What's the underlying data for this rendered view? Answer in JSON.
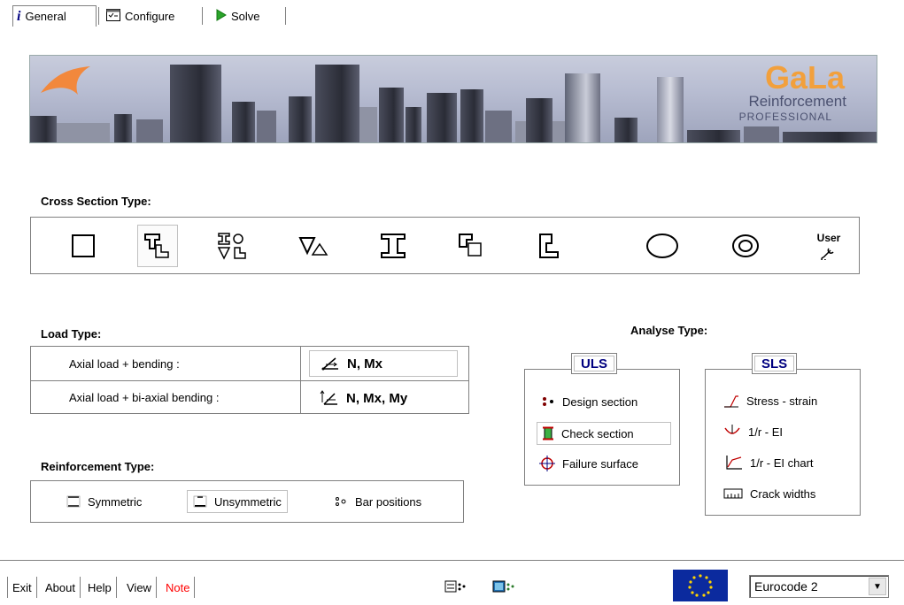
{
  "tabs": [
    {
      "label": "General",
      "icon": "info-icon"
    },
    {
      "label": "Configure",
      "icon": "configure-icon"
    },
    {
      "label": "Solve",
      "icon": "play-icon"
    }
  ],
  "banner": {
    "title": "GaLa",
    "subtitle": "Reinforcement",
    "edition": "PROFESSIONAL"
  },
  "cross_section": {
    "label": "Cross Section Type:",
    "user_label": "User",
    "selected_index": 1,
    "types": [
      "rectangle",
      "t-section",
      "multi-section",
      "triangle",
      "i-section",
      "box-section",
      "l-section",
      "circle",
      "ring",
      "user"
    ]
  },
  "load_type": {
    "label": "Load Type:",
    "rows": [
      {
        "description": "Axial load + bending :",
        "value": "N, Mx"
      },
      {
        "description": "Axial load + bi-axial bending :",
        "value": "N, Mx, My"
      }
    ]
  },
  "analyse_type": {
    "label": "Analyse Type:",
    "uls": {
      "title": "ULS",
      "items": [
        "Design section",
        "Check section",
        "Failure surface"
      ]
    },
    "sls": {
      "title": "SLS",
      "items": [
        "Stress - strain",
        "1/r - EI",
        "1/r - EI chart",
        "Crack widths"
      ]
    }
  },
  "reinforcement_type": {
    "label": "Reinforcement Type:",
    "items": [
      "Symmetric",
      "Unsymmetric",
      "Bar positions"
    ]
  },
  "bottom_bar": {
    "buttons": [
      "Exit",
      "About",
      "Help",
      "View",
      "Note"
    ],
    "note_color": "#ff0000",
    "code_select": "Eurocode 2"
  },
  "colors": {
    "accent_blue": "#000080",
    "banner_orange": "#f2a03c"
  }
}
